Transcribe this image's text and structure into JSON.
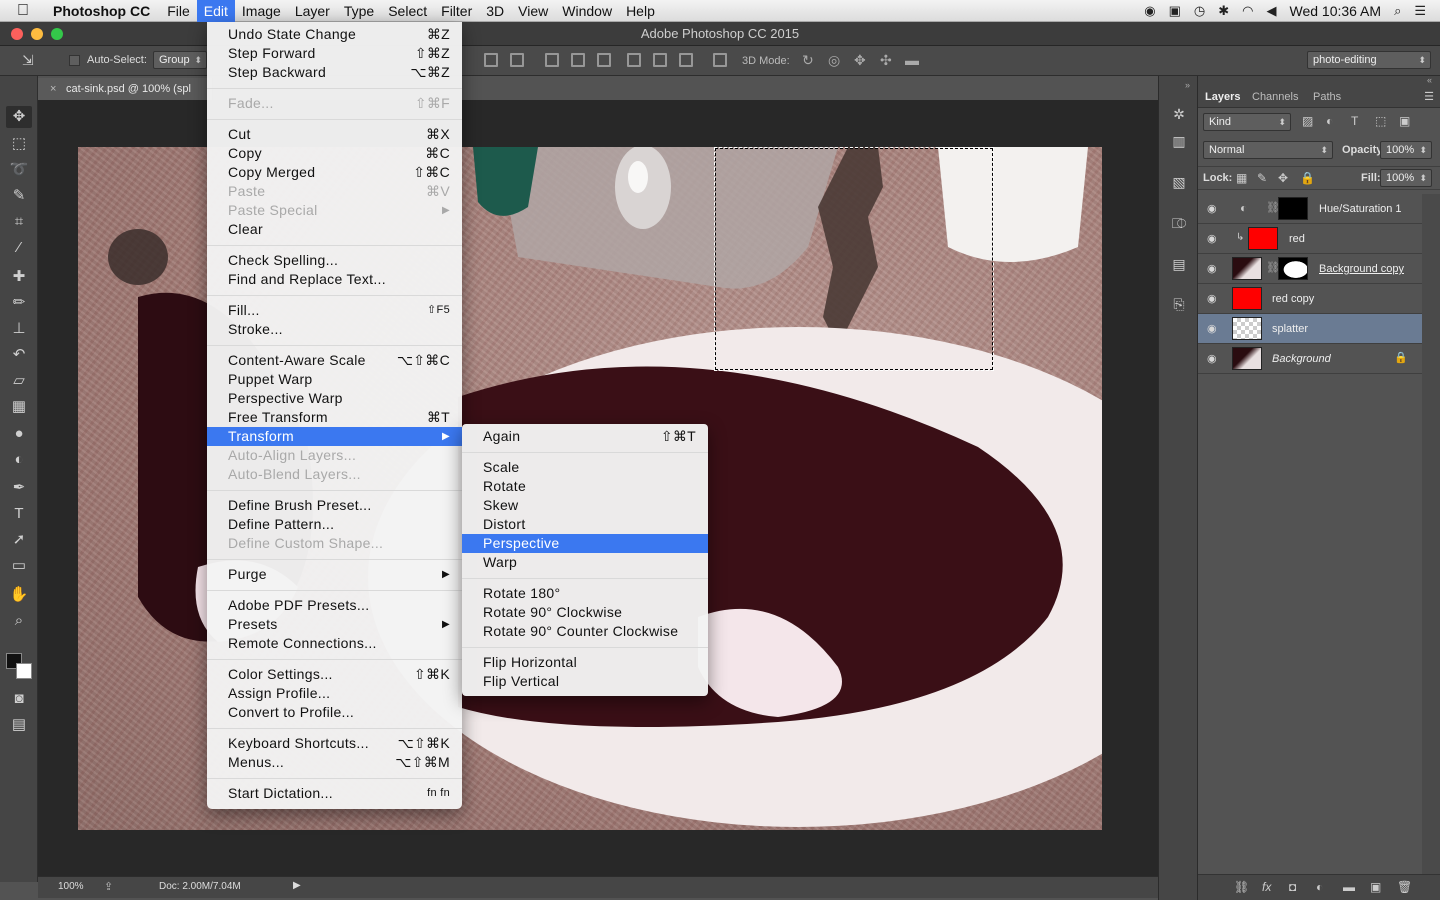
{
  "menubar": {
    "app": "Photoshop CC",
    "items": [
      "File",
      "Edit",
      "Image",
      "Layer",
      "Type",
      "Select",
      "Filter",
      "3D",
      "View",
      "Window",
      "Help"
    ],
    "active": "Edit",
    "clock": "Wed 10:36 AM"
  },
  "window": {
    "title": "Adobe Photoshop CC 2015"
  },
  "options": {
    "auto_select_label": "Auto-Select:",
    "auto_select_value": "Group",
    "three_d_mode": "3D Mode:",
    "workspace": "photo-editing"
  },
  "document": {
    "tab": "cat-sink.psd @ 100% (spl",
    "zoom": "100%",
    "doc_size": "Doc: 2.00M/7.04M"
  },
  "edit_menu": [
    {
      "label": "Undo State Change",
      "shortcut": "⌘Z"
    },
    {
      "label": "Step Forward",
      "shortcut": "⇧⌘Z"
    },
    {
      "label": "Step Backward",
      "shortcut": "⌥⌘Z"
    },
    {
      "label": "Fade...",
      "shortcut": "⇧⌘F",
      "disabled": true
    },
    {
      "label": "Cut",
      "shortcut": "⌘X"
    },
    {
      "label": "Copy",
      "shortcut": "⌘C"
    },
    {
      "label": "Copy Merged",
      "shortcut": "⇧⌘C"
    },
    {
      "label": "Paste",
      "shortcut": "⌘V",
      "disabled": true
    },
    {
      "label": "Paste Special",
      "shortcut": "",
      "disabled": true
    },
    {
      "label": "Clear",
      "shortcut": ""
    },
    {
      "label": "Check Spelling...",
      "shortcut": ""
    },
    {
      "label": "Find and Replace Text...",
      "shortcut": ""
    },
    {
      "label": "Fill...",
      "shortcut": "⇧F5"
    },
    {
      "label": "Stroke...",
      "shortcut": ""
    },
    {
      "label": "Content-Aware Scale",
      "shortcut": "⌥⇧⌘C"
    },
    {
      "label": "Puppet Warp",
      "shortcut": ""
    },
    {
      "label": "Perspective Warp",
      "shortcut": ""
    },
    {
      "label": "Free Transform",
      "shortcut": "⌘T"
    },
    {
      "label": "Transform",
      "shortcut": ""
    },
    {
      "label": "Auto-Align Layers...",
      "shortcut": "",
      "disabled": true
    },
    {
      "label": "Auto-Blend Layers...",
      "shortcut": "",
      "disabled": true
    },
    {
      "label": "Define Brush Preset...",
      "shortcut": ""
    },
    {
      "label": "Define Pattern...",
      "shortcut": ""
    },
    {
      "label": "Define Custom Shape...",
      "shortcut": "",
      "disabled": true
    },
    {
      "label": "Purge",
      "shortcut": ""
    },
    {
      "label": "Adobe PDF Presets...",
      "shortcut": ""
    },
    {
      "label": "Presets",
      "shortcut": ""
    },
    {
      "label": "Remote Connections...",
      "shortcut": ""
    },
    {
      "label": "Color Settings...",
      "shortcut": "⇧⌘K"
    },
    {
      "label": "Assign Profile...",
      "shortcut": ""
    },
    {
      "label": "Convert to Profile...",
      "shortcut": ""
    },
    {
      "label": "Keyboard Shortcuts...",
      "shortcut": "⌥⇧⌘K"
    },
    {
      "label": "Menus...",
      "shortcut": "⌥⇧⌘M"
    },
    {
      "label": "Start Dictation...",
      "shortcut": "fn fn"
    }
  ],
  "transform_menu": [
    {
      "label": "Again",
      "shortcut": "⇧⌘T"
    },
    {
      "label": "Scale",
      "shortcut": ""
    },
    {
      "label": "Rotate",
      "shortcut": ""
    },
    {
      "label": "Skew",
      "shortcut": ""
    },
    {
      "label": "Distort",
      "shortcut": ""
    },
    {
      "label": "Perspective",
      "shortcut": ""
    },
    {
      "label": "Warp",
      "shortcut": ""
    },
    {
      "label": "Rotate 180°",
      "shortcut": ""
    },
    {
      "label": "Rotate 90° Clockwise",
      "shortcut": ""
    },
    {
      "label": "Rotate 90° Counter Clockwise",
      "shortcut": ""
    },
    {
      "label": "Flip Horizontal",
      "shortcut": ""
    },
    {
      "label": "Flip Vertical",
      "shortcut": ""
    }
  ],
  "layers_panel": {
    "tabs": [
      "Layers",
      "Channels",
      "Paths"
    ],
    "filter": "Kind",
    "blend_mode": "Normal",
    "opacity_label": "Opacity:",
    "opacity": "100%",
    "lock_label": "Lock:",
    "fill_label": "Fill:",
    "fill": "100%",
    "layers": [
      {
        "name": "Hue/Saturation 1"
      },
      {
        "name": "red"
      },
      {
        "name": "Background copy"
      },
      {
        "name": "red copy"
      },
      {
        "name": "splatter",
        "selected": true
      },
      {
        "name": "Background"
      }
    ]
  },
  "colors": {
    "highlight": "#3b78f0",
    "selected_layer": "#6a7b93",
    "red_fill": "#ff0000"
  }
}
